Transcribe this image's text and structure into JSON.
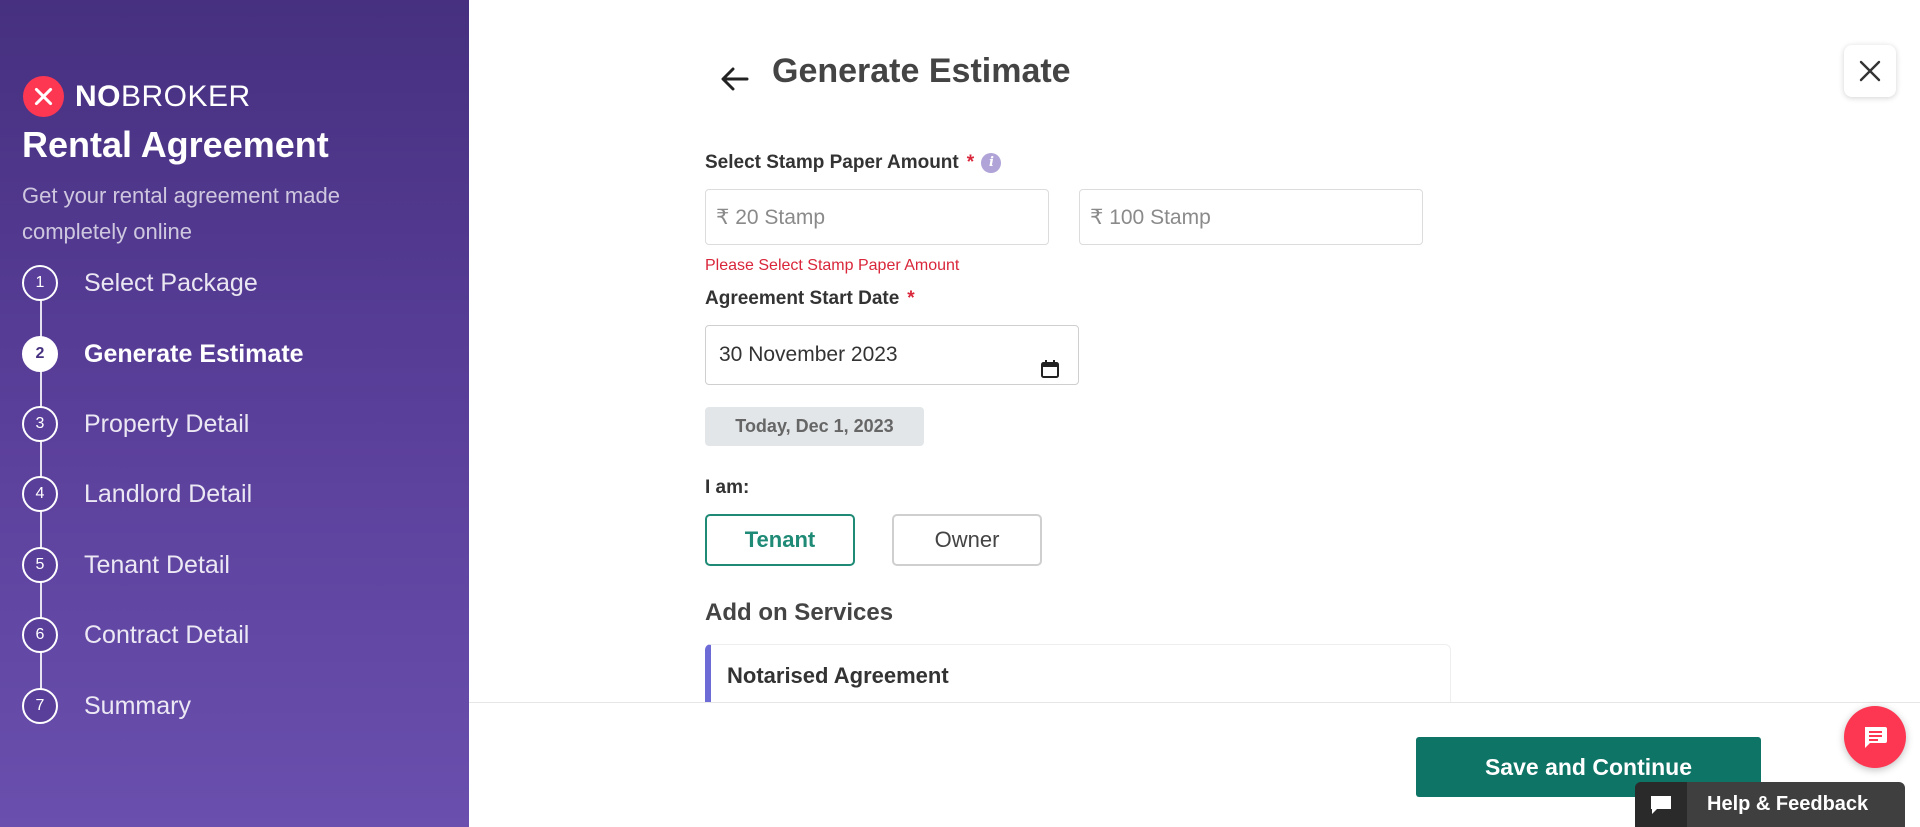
{
  "sidebar": {
    "brand_bold": "NO",
    "brand_light": "BROKER",
    "title": "Rental Agreement",
    "subtitle": "Get your rental agreement made completely online",
    "steps": [
      {
        "num": "1",
        "label": "Select Package"
      },
      {
        "num": "2",
        "label": "Generate Estimate"
      },
      {
        "num": "3",
        "label": "Property Detail"
      },
      {
        "num": "4",
        "label": "Landlord Detail"
      },
      {
        "num": "5",
        "label": "Tenant Detail"
      },
      {
        "num": "6",
        "label": "Contract Detail"
      },
      {
        "num": "7",
        "label": "Summary"
      }
    ],
    "active_step": 2
  },
  "header": {
    "title": "Generate Estimate"
  },
  "form": {
    "stamp_label": "Select Stamp Paper Amount",
    "required_mark": "*",
    "info_glyph": "i",
    "stamp_options": [
      "₹ 20 Stamp",
      "₹ 100 Stamp"
    ],
    "stamp_error": "Please Select Stamp Paper Amount",
    "date_label": "Agreement Start Date",
    "date_value": "30 November 2023",
    "today_chip": "Today, Dec 1, 2023",
    "role_label": "I am:",
    "roles": [
      "Tenant",
      "Owner"
    ],
    "selected_role": "Tenant",
    "addons_title": "Add on Services",
    "addon_card_title": "Notarised Agreement"
  },
  "footer": {
    "save_label": "Save and Continue"
  },
  "widgets": {
    "help_label": "Help & Feedback"
  },
  "colors": {
    "sidebar_top": "#46307f",
    "sidebar_bottom": "#6a4fae",
    "brand_red": "#fd3752",
    "primary_green": "#0d7466",
    "selected_teal": "#1f8a76",
    "error_red": "#d9263a",
    "addon_accent": "#6d6bd6"
  },
  "icons": {
    "back": "arrow-left-icon",
    "close": "close-icon",
    "calendar": "calendar-icon",
    "info": "info-icon",
    "chat": "chat-icon",
    "help": "speech-bubble-icon"
  }
}
